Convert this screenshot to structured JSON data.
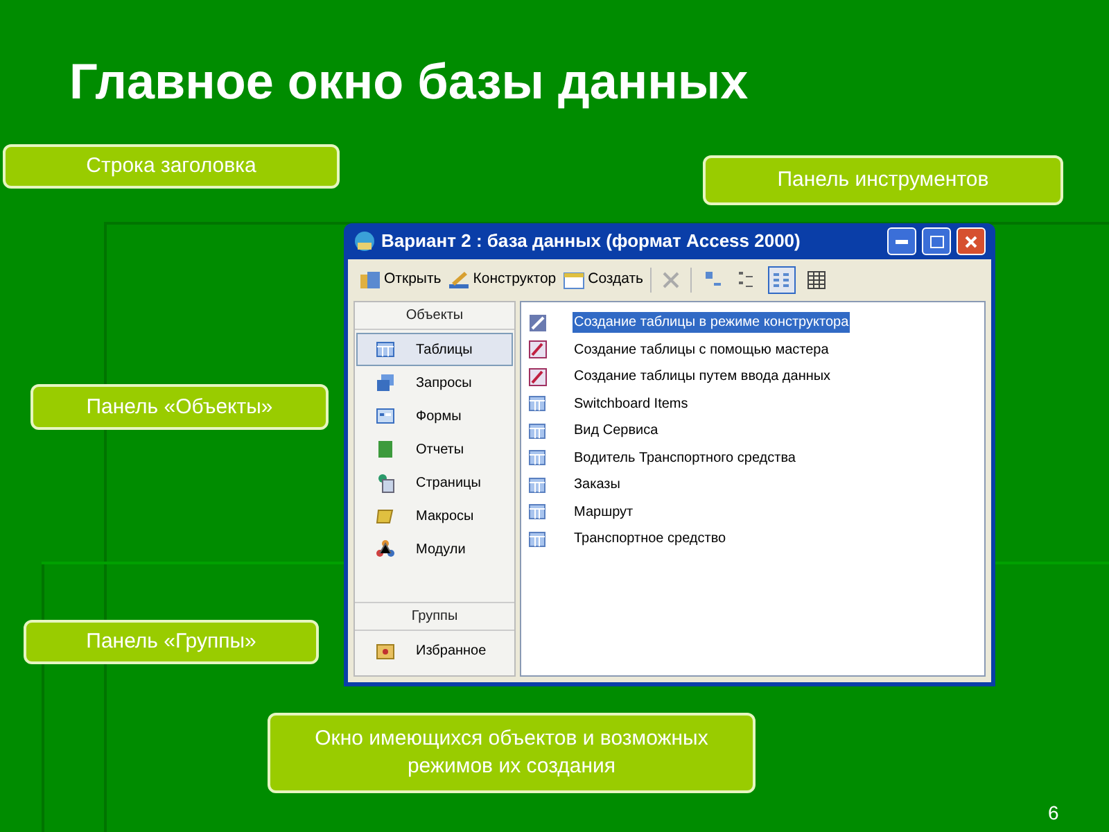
{
  "slide": {
    "title": "Главное окно базы данных",
    "page_number": "6"
  },
  "callouts": [
    {
      "text": "Строка заголовка",
      "kind": "title"
    },
    {
      "text": "Панель инструментов",
      "kind": "toolbar"
    },
    {
      "text": "Панель «Объекты»",
      "kind": "objects"
    },
    {
      "text": "Панель «Группы»",
      "kind": "groups"
    },
    {
      "text": "Окно имеющихся  объектов и возможных режимов их создания",
      "kind": "list"
    }
  ],
  "window": {
    "title": "Вариант 2 : база данных (формат Access 2000)",
    "toolbar": [
      {
        "label": "Открыть",
        "kind": "open"
      },
      {
        "label": "Конструктор",
        "kind": "design"
      },
      {
        "label": "Создать",
        "kind": "new"
      }
    ],
    "view_buttons": [
      {
        "kind": "large",
        "selected": false
      },
      {
        "kind": "small",
        "selected": false
      },
      {
        "kind": "list",
        "selected": true
      },
      {
        "kind": "details",
        "selected": false
      }
    ],
    "objects": {
      "header": "Объекты",
      "items": [
        {
          "label": "Таблицы",
          "kind": "table",
          "selected": true
        },
        {
          "label": "Запросы",
          "kind": "query",
          "selected": false
        },
        {
          "label": "Формы",
          "kind": "form",
          "selected": false
        },
        {
          "label": "Отчеты",
          "kind": "report",
          "selected": false
        },
        {
          "label": "Страницы",
          "kind": "page",
          "selected": false
        },
        {
          "label": "Макросы",
          "kind": "macro",
          "selected": false
        },
        {
          "label": "Модули",
          "kind": "module",
          "selected": false
        }
      ]
    },
    "groups": {
      "header": "Группы",
      "items": [
        {
          "label": "Избранное",
          "kind": "favorites",
          "selected": false
        }
      ]
    },
    "list": [
      {
        "label": "Создание таблицы в режиме конструктора",
        "kind": "design",
        "selected": true
      },
      {
        "label": "Создание таблицы с помощью мастера",
        "kind": "wizard",
        "selected": false
      },
      {
        "label": "Создание таблицы путем ввода данных",
        "kind": "wizard",
        "selected": false
      },
      {
        "label": "Switchboard Items",
        "kind": "table",
        "selected": false
      },
      {
        "label": "Вид Сервиса",
        "kind": "table",
        "selected": false
      },
      {
        "label": "Водитель Транспортного средства",
        "kind": "table",
        "selected": false
      },
      {
        "label": "Заказы",
        "kind": "table",
        "selected": false
      },
      {
        "label": "Маршрут",
        "kind": "table",
        "selected": false
      },
      {
        "label": "Транспортное средство",
        "kind": "table",
        "selected": false
      }
    ]
  }
}
